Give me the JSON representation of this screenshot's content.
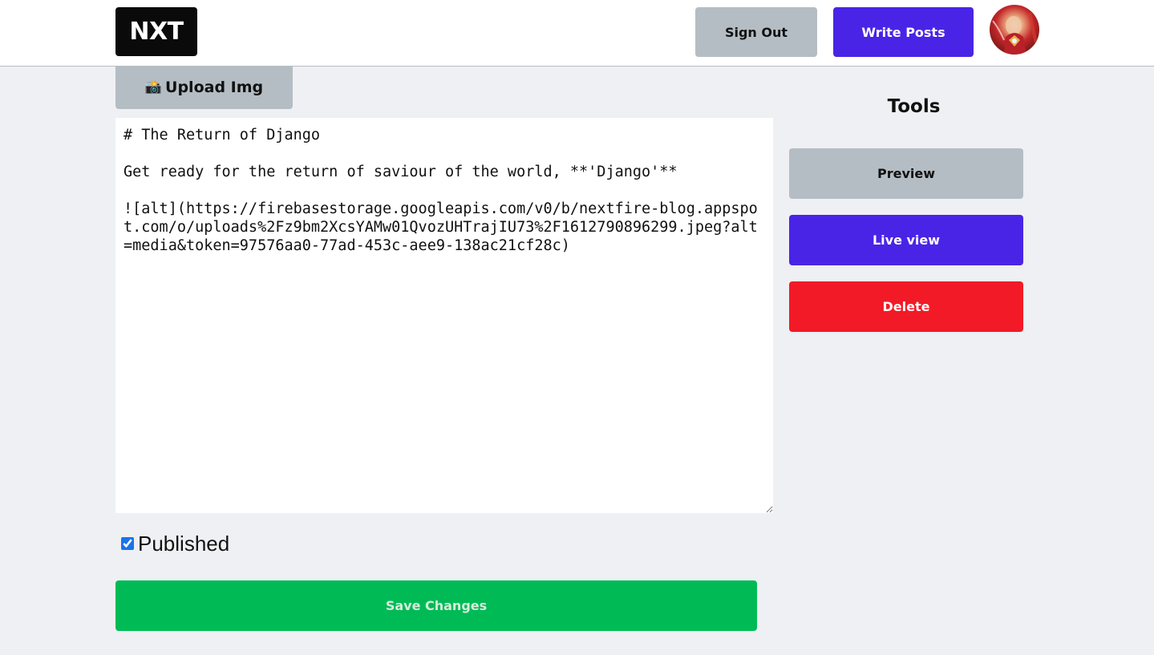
{
  "navbar": {
    "logo_text": "NXT",
    "signout_label": "Sign Out",
    "write_posts_label": "Write Posts"
  },
  "editor": {
    "upload_label": "Upload Img",
    "upload_icon": "📸",
    "content": "# The Return of Django\n\nGet ready for the return of saviour of the world, **'Django'**\n\n![alt](https://firebasestorage.googleapis.com/v0/b/nextfire-blog.appspot.com/o/uploads%2Fz9bm2XcsYAMw01QvozUHTrajIU73%2F1612790896299.jpeg?alt=media&token=97576aa0-77ad-453c-aee9-138ac21cf28c)",
    "published_label": "Published",
    "published_checked": true,
    "save_label": "Save Changes"
  },
  "tools": {
    "title": "Tools",
    "preview_label": "Preview",
    "live_view_label": "Live view",
    "delete_label": "Delete"
  },
  "colors": {
    "primary": "#4a24e6",
    "danger": "#f21a26",
    "success": "#00bb55",
    "gray": "#b5bdc4",
    "background": "#eef0f3"
  }
}
